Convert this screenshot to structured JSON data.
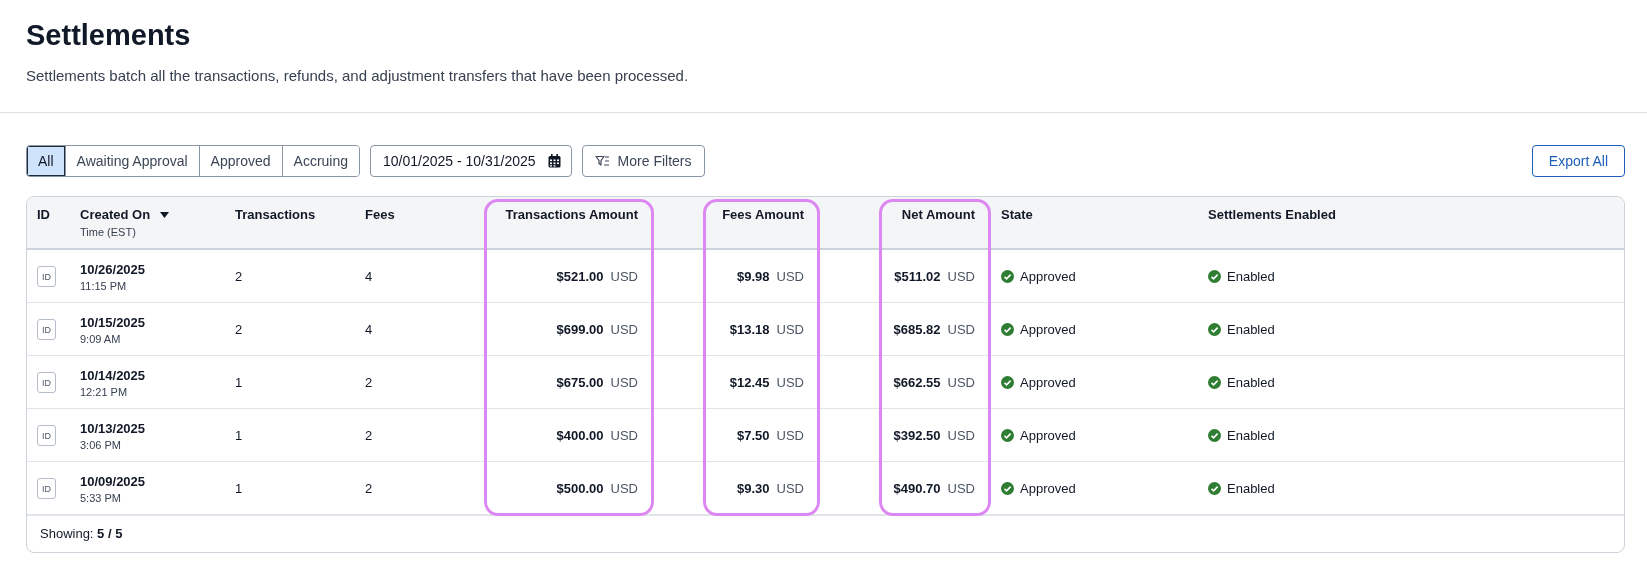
{
  "page": {
    "title": "Settlements",
    "description": "Settlements batch all the transactions, refunds, and adjustment transfers that have been processed."
  },
  "filters": {
    "tabs": [
      {
        "label": "All",
        "selected": true
      },
      {
        "label": "Awaiting Approval",
        "selected": false
      },
      {
        "label": "Approved",
        "selected": false
      },
      {
        "label": "Accruing",
        "selected": false
      }
    ],
    "date_range": {
      "value": "10/01/2025 - 10/31/2025"
    },
    "more_filters": "More Filters"
  },
  "export_button": "Export All",
  "table": {
    "columns": [
      {
        "label": "ID",
        "kind": "id",
        "sorted": false,
        "highlighted": false
      },
      {
        "label": "Created On",
        "sublabel": "Time (EST)",
        "kind": "datetime",
        "sorted": true,
        "highlighted": false
      },
      {
        "label": "Transactions",
        "kind": "text",
        "sorted": false,
        "highlighted": false
      },
      {
        "label": "Fees",
        "kind": "text",
        "sorted": false,
        "highlighted": false
      },
      {
        "label": "Transactions Amount",
        "kind": "amount",
        "sorted": false,
        "highlighted": true
      },
      {
        "label": "Fees Amount",
        "kind": "amount",
        "sorted": false,
        "highlighted": true
      },
      {
        "label": "Net Amount",
        "kind": "amount",
        "sorted": false,
        "highlighted": true
      },
      {
        "label": "State",
        "kind": "status",
        "sorted": false,
        "highlighted": false
      },
      {
        "label": "Settlements Enabled",
        "kind": "status",
        "sorted": false,
        "highlighted": false
      }
    ],
    "rows": [
      {
        "cells": [
          {
            "badge": "ID"
          },
          {
            "date": "10/26/2025",
            "time": "11:15 PM"
          },
          "2",
          "4",
          {
            "value": "$521.00",
            "currency": "USD"
          },
          {
            "value": "$9.98",
            "currency": "USD"
          },
          {
            "value": "$511.02",
            "currency": "USD"
          },
          "Approved",
          "Enabled"
        ]
      },
      {
        "cells": [
          {
            "badge": "ID"
          },
          {
            "date": "10/15/2025",
            "time": "9:09 AM"
          },
          "2",
          "4",
          {
            "value": "$699.00",
            "currency": "USD"
          },
          {
            "value": "$13.18",
            "currency": "USD"
          },
          {
            "value": "$685.82",
            "currency": "USD"
          },
          "Approved",
          "Enabled"
        ]
      },
      {
        "cells": [
          {
            "badge": "ID"
          },
          {
            "date": "10/14/2025",
            "time": "12:21 PM"
          },
          "1",
          "2",
          {
            "value": "$675.00",
            "currency": "USD"
          },
          {
            "value": "$12.45",
            "currency": "USD"
          },
          {
            "value": "$662.55",
            "currency": "USD"
          },
          "Approved",
          "Enabled"
        ]
      },
      {
        "cells": [
          {
            "badge": "ID"
          },
          {
            "date": "10/13/2025",
            "time": "3:06 PM"
          },
          "1",
          "2",
          {
            "value": "$400.00",
            "currency": "USD"
          },
          {
            "value": "$7.50",
            "currency": "USD"
          },
          {
            "value": "$392.50",
            "currency": "USD"
          },
          "Approved",
          "Enabled"
        ]
      },
      {
        "cells": [
          {
            "badge": "ID"
          },
          {
            "date": "10/09/2025",
            "time": "5:33 PM"
          },
          "1",
          "2",
          {
            "value": "$500.00",
            "currency": "USD"
          },
          {
            "value": "$9.30",
            "currency": "USD"
          },
          {
            "value": "$490.70",
            "currency": "USD"
          },
          "Approved",
          "Enabled"
        ]
      }
    ],
    "footer": "Showing: **5 / 5**"
  }
}
